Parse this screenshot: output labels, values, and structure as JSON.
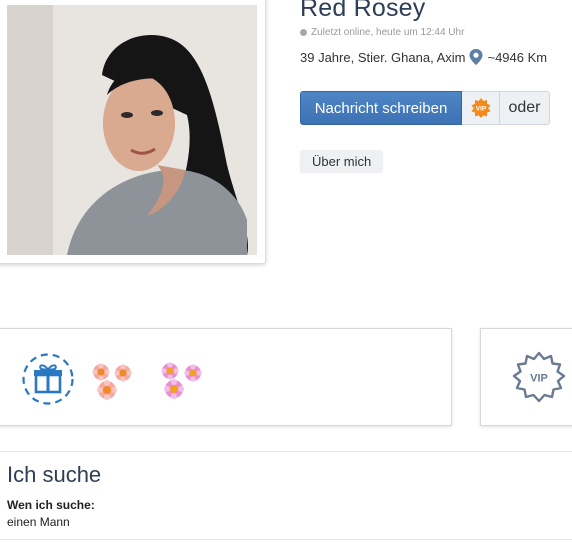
{
  "profile": {
    "name": "Red Rosey",
    "online_status": "Zuletzt online, heute um 12:44 Uhr",
    "details": "39 Jahre, Stier. Ghana, Axim",
    "distance": "~4946 Km",
    "photo_alt": ""
  },
  "actions": {
    "message_label": "Nachricht schreiben",
    "vip_badge": "VIP",
    "or_label": "oder"
  },
  "tabs": {
    "about_label": "Über mich"
  },
  "gifts": {
    "vip_label": "VIP",
    "items": [
      "gift-icon",
      "flower-bouquet-orange-icon",
      "flower-bouquet-pink-icon"
    ]
  },
  "search": {
    "title": "Ich suche",
    "label": "Wen ich suche:",
    "value": "einen Mann"
  },
  "colors": {
    "primary": "#3d72b4",
    "heading": "#2e3e55",
    "vip_icon": "#6a7a92"
  }
}
